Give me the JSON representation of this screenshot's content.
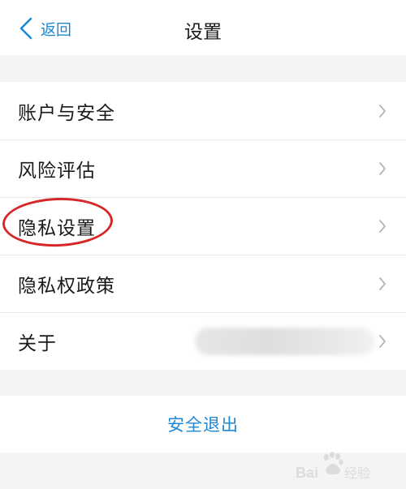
{
  "nav": {
    "back_label": "返回",
    "title": "设置"
  },
  "menu": {
    "items": [
      {
        "label": "账户与安全",
        "icon": "chevron-right-icon"
      },
      {
        "label": "风险评估",
        "icon": "chevron-right-icon"
      },
      {
        "label": "隐私设置",
        "icon": "chevron-right-icon"
      },
      {
        "label": "隐私权政策",
        "icon": "chevron-right-icon"
      },
      {
        "label": "关于",
        "value": "",
        "icon": "chevron-right-icon"
      }
    ]
  },
  "logout": {
    "label": "安全退出"
  },
  "watermark": {
    "text": "Baidu 经验"
  },
  "colors": {
    "accent": "#1e88d6",
    "highlight": "#d62828",
    "background": "#f4f4f4",
    "row_background": "#ffffff",
    "chevron": "#b5b5b5"
  }
}
